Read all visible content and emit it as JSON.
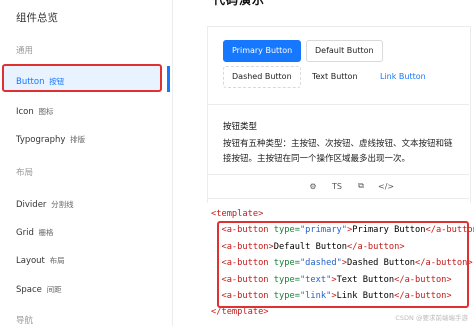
{
  "sidebar": {
    "title": "组件总览",
    "groups": [
      "通用",
      "布局",
      "导航"
    ],
    "items": [
      {
        "label": "Button",
        "sub": "按钮"
      },
      {
        "label": "Icon",
        "sub": "图标"
      },
      {
        "label": "Typography",
        "sub": "排版"
      },
      {
        "label": "Divider",
        "sub": "分割线"
      },
      {
        "label": "Grid",
        "sub": "栅格"
      },
      {
        "label": "Layout",
        "sub": "布局"
      },
      {
        "label": "Space",
        "sub": "间距"
      }
    ]
  },
  "main": {
    "heading": "代码演示",
    "buttons": {
      "primary": "Primary Button",
      "default": "Default Button",
      "dashed": "Dashed Button",
      "text": "Text Button",
      "link": "Link Button"
    },
    "desc_title": "按钮类型",
    "desc_text": "按钮有五种类型：主按钮、次按钮、虚线按钮、文本按钮和链接按钮。主按钮在同一个操作区域最多出现一次。",
    "toolbar": {
      "ts_label": "TS"
    }
  },
  "code": {
    "open_template": "<template>",
    "close_template": "</template>",
    "lines": [
      {
        "type": "primary",
        "text": "Primary Button"
      },
      {
        "type": "",
        "text": "Default Button"
      },
      {
        "type": "dashed",
        "text": "Dashed Button"
      },
      {
        "type": "text",
        "text": "Text Button"
      },
      {
        "type": "link",
        "text": "Link Button"
      }
    ]
  },
  "watermark": "CSDN @要求前端端手游"
}
